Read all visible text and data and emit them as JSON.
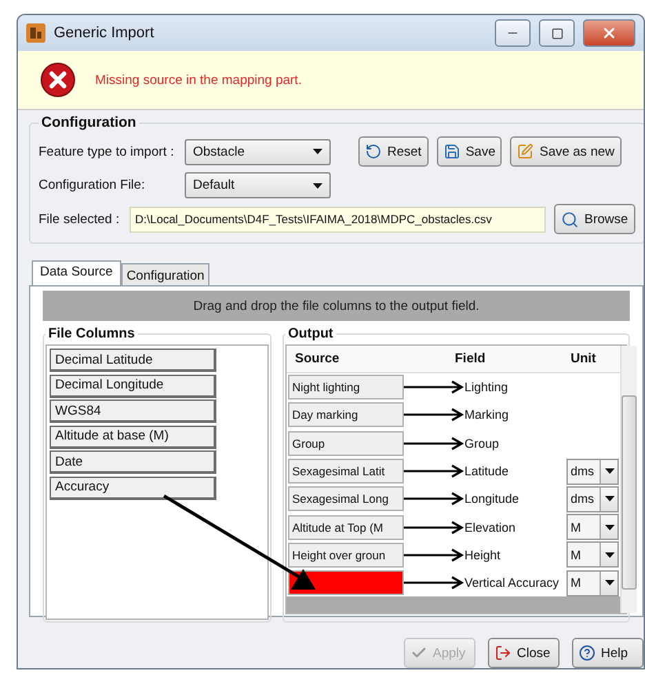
{
  "window": {
    "title": "Generic Import"
  },
  "error": {
    "message": "Missing source in the mapping part."
  },
  "configuration": {
    "title": "Configuration",
    "feature_type": {
      "label": "Feature type to import :",
      "value": "Obstacle"
    },
    "config_file": {
      "label": "Configuration File:",
      "value": "Default"
    },
    "file_selected": {
      "label": "File selected :",
      "value": "D:\\Local_Documents\\D4F_Tests\\IFAIMA_2018\\MDPC_obstacles.csv"
    },
    "buttons": [
      {
        "label": "Reset",
        "kind": "reset"
      },
      {
        "label": "Save",
        "kind": "save"
      },
      {
        "label": "Save as new",
        "kind": "save_new"
      }
    ],
    "browse": "Browse"
  },
  "tabs": [
    {
      "label": "Data Source",
      "selected": true
    },
    {
      "label": "Configuration",
      "selected": false
    }
  ],
  "hint": "Drag and drop the file columns to the output field.",
  "file_columns": {
    "title": "File Columns",
    "items": [
      "Decimal Latitude",
      "Decimal Longitude",
      "WGS84",
      "Altitude at base (M)",
      "Date",
      "Accuracy"
    ]
  },
  "output": {
    "title": "Output",
    "columns": [
      "Source",
      "Field",
      "Unit"
    ],
    "rows": [
      {
        "source": "Night lighting",
        "field": "Lighting",
        "missing": false
      },
      {
        "source": "Day marking",
        "field": "Marking",
        "missing": false
      },
      {
        "source": "Group",
        "field": "Group",
        "missing": false
      },
      {
        "source": "Sexagesimal Latit",
        "field": "Latitude",
        "unit": "dms",
        "missing": false
      },
      {
        "source": "Sexagesimal Long",
        "field": "Longitude",
        "unit": "dms",
        "missing": false
      },
      {
        "source": "Altitude at Top   (M",
        "field": "Elevation",
        "unit": "M",
        "missing": false
      },
      {
        "source": "Height over groun",
        "field": "Height",
        "unit": "M",
        "missing": false
      },
      {
        "field": "Vertical Accuracy",
        "unit": "M",
        "missing": true
      }
    ]
  },
  "footer_buttons": [
    {
      "label": "Apply",
      "kind": "apply",
      "disabled": true
    },
    {
      "label": "Close",
      "kind": "close",
      "disabled": false
    },
    {
      "label": "Help",
      "kind": "help",
      "disabled": false
    }
  ]
}
